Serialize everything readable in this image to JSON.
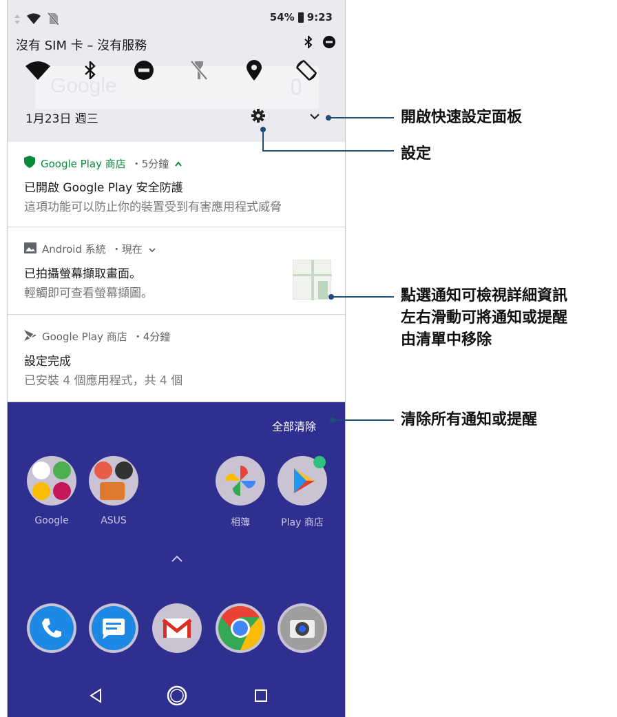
{
  "status_bar": {
    "battery": "54%",
    "time": "9:23"
  },
  "carrier": {
    "text": "沒有 SIM 卡 – 沒有服務"
  },
  "quick_settings": [
    "wifi-icon",
    "bluetooth-icon",
    "do-not-disturb-icon",
    "flashlight-off-icon",
    "location-icon",
    "auto-rotate-icon"
  ],
  "date_row": {
    "date": "1月23日 週三"
  },
  "notifications": [
    {
      "app": "Google Play 商店",
      "time": "・5分鐘",
      "title": "已開啟 Google Play 安全防護",
      "text": "這項功能可以防止你的裝置受到有害應用程式威脅"
    },
    {
      "app": "Android 系統",
      "time": "・現在",
      "title": "已拍攝螢幕擷取畫面。",
      "text": "輕觸即可查看螢幕擷圖。"
    },
    {
      "app": "Google Play 商店",
      "time": "・4分鐘",
      "title": "設定完成",
      "text": "已安裝 4 個應用程式，共 4 個"
    }
  ],
  "home": {
    "clear_all": "全部清除",
    "apps": [
      {
        "label": "Google"
      },
      {
        "label": "ASUS"
      },
      {
        "label": "相簿"
      },
      {
        "label": "Play 商店"
      }
    ],
    "dock": [
      "phone-icon",
      "messages-icon",
      "gmail-icon",
      "chrome-icon",
      "camera-icon"
    ]
  },
  "callouts": {
    "expand": "開啟快速設定面板",
    "settings": "設定",
    "notif_line1": "點選通知可檢視詳細資訊",
    "notif_line2": "左右滑動可將通知或提醒",
    "notif_line3": "由清單中移除",
    "clear": "清除所有通知或提醒"
  },
  "colors": {
    "accent": "#1f4e79",
    "home_bg": "#2e2f8e",
    "shade_bg": "#eaeaef"
  }
}
